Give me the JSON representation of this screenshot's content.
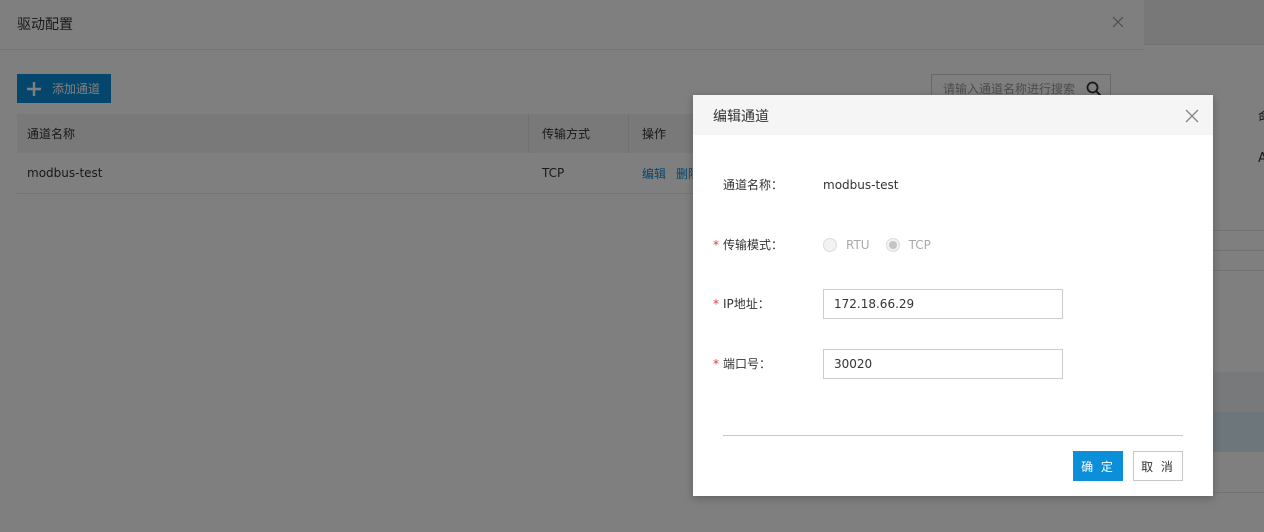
{
  "background_page": {
    "partial_chars": [
      "命",
      "A"
    ]
  },
  "drawer": {
    "title": "驱动配置",
    "add_button_label": "添加通道",
    "search": {
      "placeholder": "请输入通道名称进行搜索",
      "value": ""
    },
    "table": {
      "columns": [
        "通道名称",
        "传输方式",
        "操作"
      ],
      "rows": [
        {
          "name": "modbus-test",
          "transport": "TCP",
          "actions": [
            "编辑",
            "删除"
          ]
        }
      ]
    }
  },
  "modal": {
    "title": "编辑通道",
    "fields": {
      "channel_name": {
        "label": "通道名称：",
        "value": "modbus-test"
      },
      "transport_mode": {
        "label": "传输模式：",
        "options": [
          "RTU",
          "TCP"
        ],
        "selected": "TCP",
        "disabled": true
      },
      "ip": {
        "label": "IP地址：",
        "value": "172.18.66.29"
      },
      "port": {
        "label": "端口号：",
        "value": "30020"
      }
    },
    "required_mark": "*",
    "ok_label": "确 定",
    "cancel_label": "取 消"
  },
  "colors": {
    "primary": "#0b8fd9",
    "required": "#e4393c",
    "mask": "rgba(0,0,0,0.5)"
  }
}
